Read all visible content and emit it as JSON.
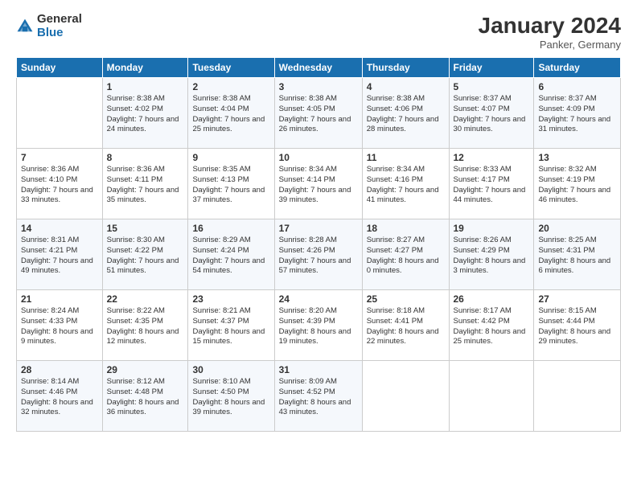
{
  "header": {
    "logo_general": "General",
    "logo_blue": "Blue",
    "month_title": "January 2024",
    "location": "Panker, Germany"
  },
  "days_of_week": [
    "Sunday",
    "Monday",
    "Tuesday",
    "Wednesday",
    "Thursday",
    "Friday",
    "Saturday"
  ],
  "weeks": [
    [
      {
        "day": "",
        "sunrise": "",
        "sunset": "",
        "daylight": ""
      },
      {
        "day": "1",
        "sunrise": "Sunrise: 8:38 AM",
        "sunset": "Sunset: 4:02 PM",
        "daylight": "Daylight: 7 hours and 24 minutes."
      },
      {
        "day": "2",
        "sunrise": "Sunrise: 8:38 AM",
        "sunset": "Sunset: 4:04 PM",
        "daylight": "Daylight: 7 hours and 25 minutes."
      },
      {
        "day": "3",
        "sunrise": "Sunrise: 8:38 AM",
        "sunset": "Sunset: 4:05 PM",
        "daylight": "Daylight: 7 hours and 26 minutes."
      },
      {
        "day": "4",
        "sunrise": "Sunrise: 8:38 AM",
        "sunset": "Sunset: 4:06 PM",
        "daylight": "Daylight: 7 hours and 28 minutes."
      },
      {
        "day": "5",
        "sunrise": "Sunrise: 8:37 AM",
        "sunset": "Sunset: 4:07 PM",
        "daylight": "Daylight: 7 hours and 30 minutes."
      },
      {
        "day": "6",
        "sunrise": "Sunrise: 8:37 AM",
        "sunset": "Sunset: 4:09 PM",
        "daylight": "Daylight: 7 hours and 31 minutes."
      }
    ],
    [
      {
        "day": "7",
        "sunrise": "Sunrise: 8:36 AM",
        "sunset": "Sunset: 4:10 PM",
        "daylight": "Daylight: 7 hours and 33 minutes."
      },
      {
        "day": "8",
        "sunrise": "Sunrise: 8:36 AM",
        "sunset": "Sunset: 4:11 PM",
        "daylight": "Daylight: 7 hours and 35 minutes."
      },
      {
        "day": "9",
        "sunrise": "Sunrise: 8:35 AM",
        "sunset": "Sunset: 4:13 PM",
        "daylight": "Daylight: 7 hours and 37 minutes."
      },
      {
        "day": "10",
        "sunrise": "Sunrise: 8:34 AM",
        "sunset": "Sunset: 4:14 PM",
        "daylight": "Daylight: 7 hours and 39 minutes."
      },
      {
        "day": "11",
        "sunrise": "Sunrise: 8:34 AM",
        "sunset": "Sunset: 4:16 PM",
        "daylight": "Daylight: 7 hours and 41 minutes."
      },
      {
        "day": "12",
        "sunrise": "Sunrise: 8:33 AM",
        "sunset": "Sunset: 4:17 PM",
        "daylight": "Daylight: 7 hours and 44 minutes."
      },
      {
        "day": "13",
        "sunrise": "Sunrise: 8:32 AM",
        "sunset": "Sunset: 4:19 PM",
        "daylight": "Daylight: 7 hours and 46 minutes."
      }
    ],
    [
      {
        "day": "14",
        "sunrise": "Sunrise: 8:31 AM",
        "sunset": "Sunset: 4:21 PM",
        "daylight": "Daylight: 7 hours and 49 minutes."
      },
      {
        "day": "15",
        "sunrise": "Sunrise: 8:30 AM",
        "sunset": "Sunset: 4:22 PM",
        "daylight": "Daylight: 7 hours and 51 minutes."
      },
      {
        "day": "16",
        "sunrise": "Sunrise: 8:29 AM",
        "sunset": "Sunset: 4:24 PM",
        "daylight": "Daylight: 7 hours and 54 minutes."
      },
      {
        "day": "17",
        "sunrise": "Sunrise: 8:28 AM",
        "sunset": "Sunset: 4:26 PM",
        "daylight": "Daylight: 7 hours and 57 minutes."
      },
      {
        "day": "18",
        "sunrise": "Sunrise: 8:27 AM",
        "sunset": "Sunset: 4:27 PM",
        "daylight": "Daylight: 8 hours and 0 minutes."
      },
      {
        "day": "19",
        "sunrise": "Sunrise: 8:26 AM",
        "sunset": "Sunset: 4:29 PM",
        "daylight": "Daylight: 8 hours and 3 minutes."
      },
      {
        "day": "20",
        "sunrise": "Sunrise: 8:25 AM",
        "sunset": "Sunset: 4:31 PM",
        "daylight": "Daylight: 8 hours and 6 minutes."
      }
    ],
    [
      {
        "day": "21",
        "sunrise": "Sunrise: 8:24 AM",
        "sunset": "Sunset: 4:33 PM",
        "daylight": "Daylight: 8 hours and 9 minutes."
      },
      {
        "day": "22",
        "sunrise": "Sunrise: 8:22 AM",
        "sunset": "Sunset: 4:35 PM",
        "daylight": "Daylight: 8 hours and 12 minutes."
      },
      {
        "day": "23",
        "sunrise": "Sunrise: 8:21 AM",
        "sunset": "Sunset: 4:37 PM",
        "daylight": "Daylight: 8 hours and 15 minutes."
      },
      {
        "day": "24",
        "sunrise": "Sunrise: 8:20 AM",
        "sunset": "Sunset: 4:39 PM",
        "daylight": "Daylight: 8 hours and 19 minutes."
      },
      {
        "day": "25",
        "sunrise": "Sunrise: 8:18 AM",
        "sunset": "Sunset: 4:41 PM",
        "daylight": "Daylight: 8 hours and 22 minutes."
      },
      {
        "day": "26",
        "sunrise": "Sunrise: 8:17 AM",
        "sunset": "Sunset: 4:42 PM",
        "daylight": "Daylight: 8 hours and 25 minutes."
      },
      {
        "day": "27",
        "sunrise": "Sunrise: 8:15 AM",
        "sunset": "Sunset: 4:44 PM",
        "daylight": "Daylight: 8 hours and 29 minutes."
      }
    ],
    [
      {
        "day": "28",
        "sunrise": "Sunrise: 8:14 AM",
        "sunset": "Sunset: 4:46 PM",
        "daylight": "Daylight: 8 hours and 32 minutes."
      },
      {
        "day": "29",
        "sunrise": "Sunrise: 8:12 AM",
        "sunset": "Sunset: 4:48 PM",
        "daylight": "Daylight: 8 hours and 36 minutes."
      },
      {
        "day": "30",
        "sunrise": "Sunrise: 8:10 AM",
        "sunset": "Sunset: 4:50 PM",
        "daylight": "Daylight: 8 hours and 39 minutes."
      },
      {
        "day": "31",
        "sunrise": "Sunrise: 8:09 AM",
        "sunset": "Sunset: 4:52 PM",
        "daylight": "Daylight: 8 hours and 43 minutes."
      },
      {
        "day": "",
        "sunrise": "",
        "sunset": "",
        "daylight": ""
      },
      {
        "day": "",
        "sunrise": "",
        "sunset": "",
        "daylight": ""
      },
      {
        "day": "",
        "sunrise": "",
        "sunset": "",
        "daylight": ""
      }
    ]
  ]
}
